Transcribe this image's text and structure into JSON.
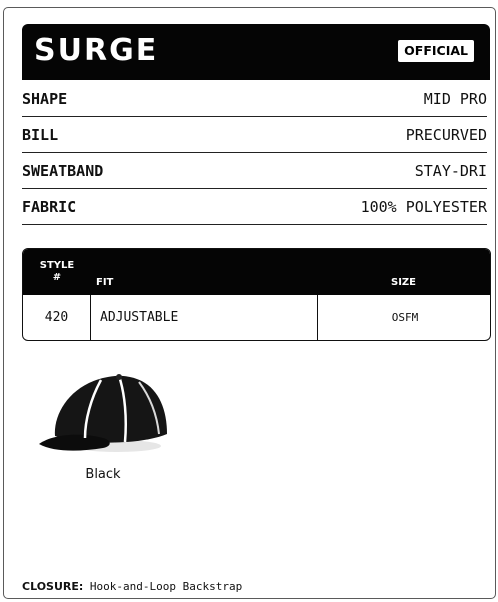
{
  "product": {
    "name": "SURGE",
    "badge": "OFFICIAL"
  },
  "specs": [
    {
      "label": "SHAPE",
      "value": "MID PRO"
    },
    {
      "label": "BILL",
      "value": "PRECURVED"
    },
    {
      "label": "SWEATBAND",
      "value": "STAY-DRI"
    },
    {
      "label": "FABRIC",
      "value": "100% POLYESTER"
    }
  ],
  "table": {
    "headers": {
      "style_line1": "STYLE",
      "style_line2": "#",
      "fit": "FIT",
      "size": "SIZE"
    },
    "rows": [
      {
        "style": "420",
        "fit": "ADJUSTABLE",
        "size": "OSFM"
      }
    ]
  },
  "colors": [
    {
      "name": "Black",
      "icon": "cap-image"
    }
  ],
  "closure": {
    "label": "CLOSURE:",
    "value": "Hook-and-Loop Backstrap"
  }
}
